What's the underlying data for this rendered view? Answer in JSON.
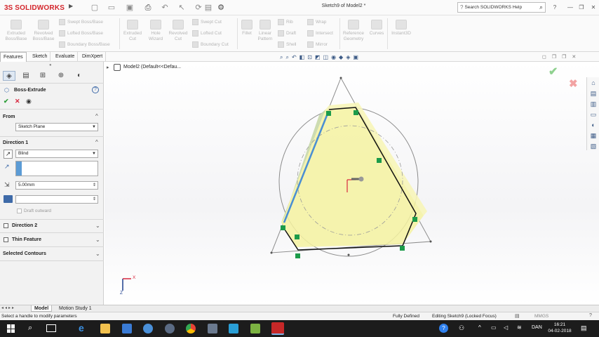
{
  "title_bar": {
    "logo_ds": "3S",
    "logo_text": "SOLIDWORKS",
    "document_title": "Sketch9 of Model2 *",
    "search_placeholder": "Search SOLIDWORKS Help",
    "help_label": "?"
  },
  "command_bar": {
    "extruded_boss": "Extruded Boss/Base",
    "revolved_boss": "Revolved Boss/Base",
    "swept_boss": "Swept Boss/Base",
    "lofted_boss": "Lofted Boss/Base",
    "boundary_boss": "Boundary Boss/Base",
    "extruded_cut": "Extruded Cut",
    "hole_wizard": "Hole Wizard",
    "revolved_cut": "Revolved Cut",
    "swept_cut": "Swept Cut",
    "lofted_cut": "Lofted Cut",
    "boundary_cut": "Boundary Cut",
    "fillet": "Fillet",
    "linear_pattern": "Linear Pattern",
    "rib": "Rib",
    "draft": "Draft",
    "shell": "Shell",
    "wrap": "Wrap",
    "intersect": "Intersect",
    "mirror": "Mirror",
    "reference_geometry": "Reference Geometry",
    "curves": "Curves",
    "instant3d": "Instant3D"
  },
  "tabs": [
    "Features",
    "Sketch",
    "Evaluate",
    "DimXpert"
  ],
  "property_manager": {
    "title": "Boss-Extrude",
    "help": "?",
    "from_label": "From",
    "from_value": "Sketch Plane",
    "direction1_label": "Direction 1",
    "end_condition": "Blind",
    "depth_value": "5.00mm",
    "draft_outward_label": "Draft outward",
    "direction2_label": "Direction 2",
    "thin_feature_label": "Thin Feature",
    "selected_contours_label": "Selected Contours"
  },
  "feature_tree": {
    "root_label": "Model2  (Default<<Defau..."
  },
  "bottom_tabs": [
    "Model",
    "Motion Study 1"
  ],
  "status": {
    "message": "Select a handle to modify parameters",
    "fully_defined": "Fully Defined",
    "editing": "Editing Sketch9 (Locked Focus)",
    "units": "MMGS"
  },
  "taskbar": {
    "time": "16:21",
    "date": "04-02-2018",
    "language": "DAN"
  },
  "axis": {
    "x_label": "X",
    "z_label": "Z"
  },
  "colors": {
    "brand_red": "#d3252b",
    "confirm_green": "#2e9e3a",
    "cancel_red": "#d7263d",
    "preview_yellow": "#f4f2a0",
    "relation_green": "#1c9b4a",
    "edge_blue": "#4a8fd4"
  }
}
